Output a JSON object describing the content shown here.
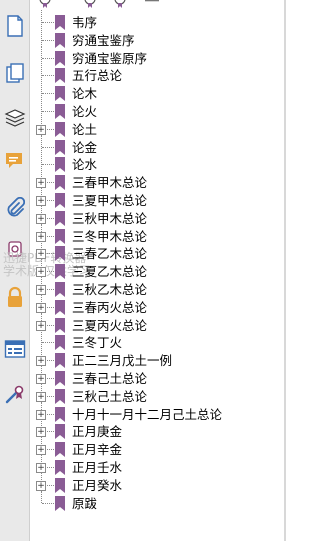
{
  "watermark": {
    "line1": "迅捷PDF转换器",
    "line2": "学术版 仅供学习"
  },
  "left_panel_icons": [
    {
      "name": "page-icon"
    },
    {
      "name": "pages-icon"
    },
    {
      "name": "layers-icon"
    },
    {
      "name": "comment-icon"
    },
    {
      "name": "paperclip-icon"
    },
    {
      "name": "signature-icon"
    },
    {
      "name": "lock-icon"
    },
    {
      "name": "form-icon"
    },
    {
      "name": "certificate-icon"
    }
  ],
  "toolbar_icons": [
    {
      "name": "add-bookmark-icon"
    },
    {
      "name": "expand-bookmark-icon"
    },
    {
      "name": "delete-bookmark-icon"
    },
    {
      "name": "bookmark-options-icon"
    }
  ],
  "bookmarks": [
    {
      "label": "韦序",
      "expandable": false
    },
    {
      "label": "穷通宝鉴序",
      "expandable": false
    },
    {
      "label": "穷通宝鉴原序",
      "expandable": false
    },
    {
      "label": "五行总论",
      "expandable": false
    },
    {
      "label": "论木",
      "expandable": false
    },
    {
      "label": "论火",
      "expandable": false
    },
    {
      "label": "论土",
      "expandable": true
    },
    {
      "label": "论金",
      "expandable": false
    },
    {
      "label": "论水",
      "expandable": false
    },
    {
      "label": "三春甲木总论",
      "expandable": true
    },
    {
      "label": "三夏甲木总论",
      "expandable": true
    },
    {
      "label": "三秋甲木总论",
      "expandable": true
    },
    {
      "label": "三冬甲木总论",
      "expandable": true
    },
    {
      "label": "三春乙木总论",
      "expandable": true
    },
    {
      "label": "三夏乙木总论",
      "expandable": true
    },
    {
      "label": "三秋乙木总论",
      "expandable": true
    },
    {
      "label": "三春丙火总论",
      "expandable": true
    },
    {
      "label": "三夏丙火总论",
      "expandable": true
    },
    {
      "label": "三冬丁火",
      "expandable": false
    },
    {
      "label": "正二三月戊土一例",
      "expandable": true
    },
    {
      "label": "三春己土总论",
      "expandable": true
    },
    {
      "label": "三秋己土总论",
      "expandable": true
    },
    {
      "label": "十月十一月十二月己土总论",
      "expandable": true
    },
    {
      "label": "正月庚金",
      "expandable": true
    },
    {
      "label": "正月辛金",
      "expandable": true
    },
    {
      "label": "正月壬水",
      "expandable": true
    },
    {
      "label": "正月癸水",
      "expandable": true
    },
    {
      "label": "原跋",
      "expandable": false
    }
  ],
  "colors": {
    "bookmark": "#8a5c95",
    "rail_bg": "#e9e9e9",
    "icon_blue": "#3a6fb5",
    "icon_orange": "#e8a23a"
  }
}
